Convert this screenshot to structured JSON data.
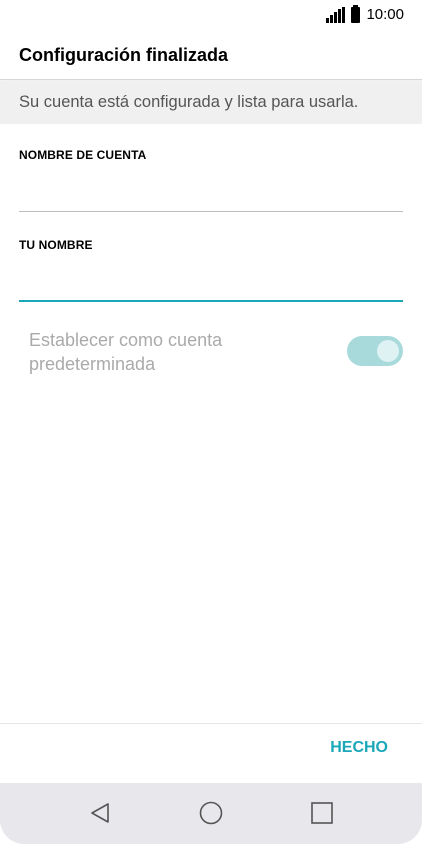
{
  "status_bar": {
    "time": "10:00"
  },
  "app_bar": {
    "title": "Configuración finalizada"
  },
  "subtitle": "Su cuenta está configurada y lista para usarla.",
  "form": {
    "account_name": {
      "label": "NOMBRE DE CUENTA",
      "value": ""
    },
    "your_name": {
      "label": "TU NOMBRE",
      "value": ""
    }
  },
  "default_account": {
    "label": "Establecer como cuenta predeterminada",
    "enabled": true
  },
  "actions": {
    "done_label": "HECHO"
  },
  "colors": {
    "accent": "#1aa7b8",
    "switch_track": "#a8dadc",
    "nav_bar": "#e8e8ec"
  },
  "nav": {
    "back_icon": "back-icon",
    "home_icon": "home-icon",
    "recents_icon": "recents-icon"
  }
}
